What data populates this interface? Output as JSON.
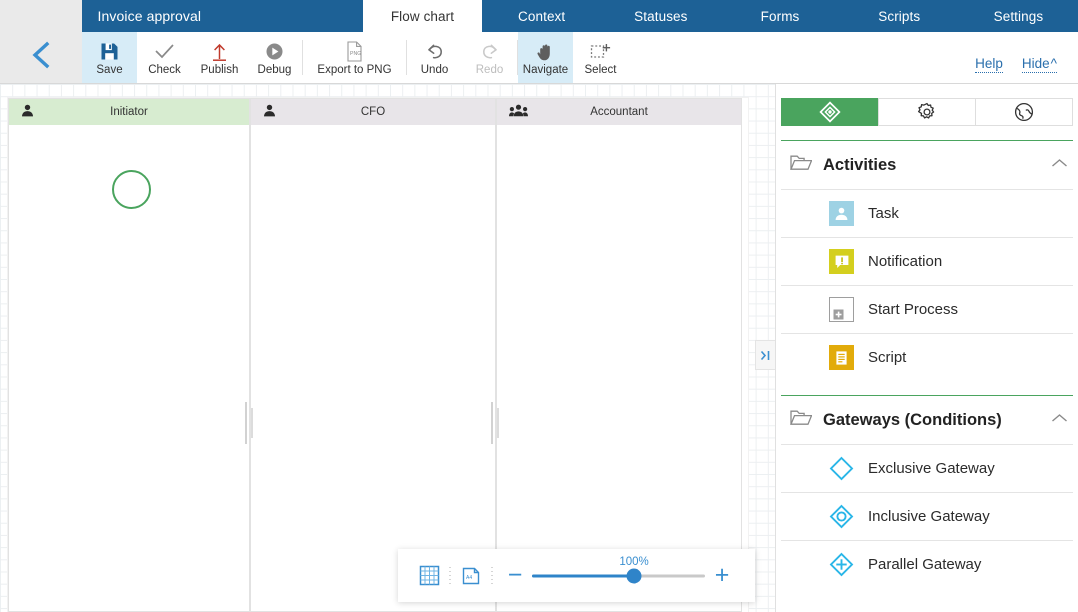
{
  "topbar": {
    "process_title": "Invoice approval",
    "tabs": [
      {
        "label": "Flow chart",
        "active": true
      },
      {
        "label": "Context",
        "active": false
      },
      {
        "label": "Statuses",
        "active": false
      },
      {
        "label": "Forms",
        "active": false
      },
      {
        "label": "Scripts",
        "active": false
      },
      {
        "label": "Settings",
        "active": false
      }
    ]
  },
  "toolbar": {
    "back_icon": "back-chevron-icon",
    "buttons": [
      {
        "label": "Save",
        "icon": "save-floppy-icon",
        "state": "selected"
      },
      {
        "label": "Check",
        "icon": "checkmark-icon",
        "state": "normal"
      },
      {
        "label": "Publish",
        "icon": "upload-arrow-icon",
        "state": "normal"
      },
      {
        "label": "Debug",
        "icon": "play-circle-icon",
        "state": "normal"
      },
      {
        "label": "Export to PNG",
        "icon": "png-file-icon",
        "state": "normal"
      },
      {
        "label": "Undo",
        "icon": "undo-arrow-icon",
        "state": "normal"
      },
      {
        "label": "Redo",
        "icon": "redo-arrow-icon",
        "state": "disabled"
      },
      {
        "label": "Navigate",
        "icon": "hand-icon",
        "state": "selected"
      },
      {
        "label": "Select",
        "icon": "marquee-select-icon",
        "state": "normal"
      }
    ],
    "help_label": "Help",
    "hide_label": "Hide",
    "hide_caret": "^"
  },
  "canvas": {
    "lanes": [
      {
        "name": "Initiator",
        "icon": "single-person-icon",
        "header_color": "#d7ecd0"
      },
      {
        "name": "CFO",
        "icon": "single-person-icon",
        "header_color": "#e8e5e9"
      },
      {
        "name": "Accountant",
        "icon": "group-people-icon",
        "header_color": "#e8e5e9"
      }
    ],
    "start_event": {
      "name": "start-event-node",
      "color": "#4aa45e"
    },
    "collapse_handle_icon": "collapse-panel-icon"
  },
  "zoombar": {
    "grid_icon": "grid-toggle-icon",
    "page_icon": "a4-page-icon",
    "minus_label": "−",
    "plus_label": "+",
    "zoom_percent": "100%",
    "zoom_value": 100
  },
  "right_panel": {
    "tabs": [
      {
        "icon": "gateway-diamond-icon",
        "active": true
      },
      {
        "icon": "gear-icon",
        "active": false
      },
      {
        "icon": "globe-icon",
        "active": false
      }
    ],
    "sections": [
      {
        "title": "Activities",
        "folder_icon": "folder-icon",
        "collapse_icon": "chevron-up-icon",
        "items": [
          {
            "label": "Task",
            "icon": "task-person-icon"
          },
          {
            "label": "Notification",
            "icon": "notification-exclamation-icon"
          },
          {
            "label": "Start Process",
            "icon": "start-process-icon"
          },
          {
            "label": "Script",
            "icon": "script-document-icon"
          }
        ]
      },
      {
        "title": "Gateways (Conditions)",
        "folder_icon": "folder-icon",
        "collapse_icon": "chevron-up-icon",
        "items": [
          {
            "label": "Exclusive Gateway",
            "icon": "exclusive-gateway-icon"
          },
          {
            "label": "Inclusive Gateway",
            "icon": "inclusive-gateway-icon"
          },
          {
            "label": "Parallel Gateway",
            "icon": "parallel-gateway-icon"
          }
        ]
      }
    ]
  },
  "colors": {
    "brand_blue": "#1d6196",
    "accent_green": "#4aa45e",
    "link_blue": "#2a6fad",
    "gateway_cyan": "#29b6e8"
  }
}
